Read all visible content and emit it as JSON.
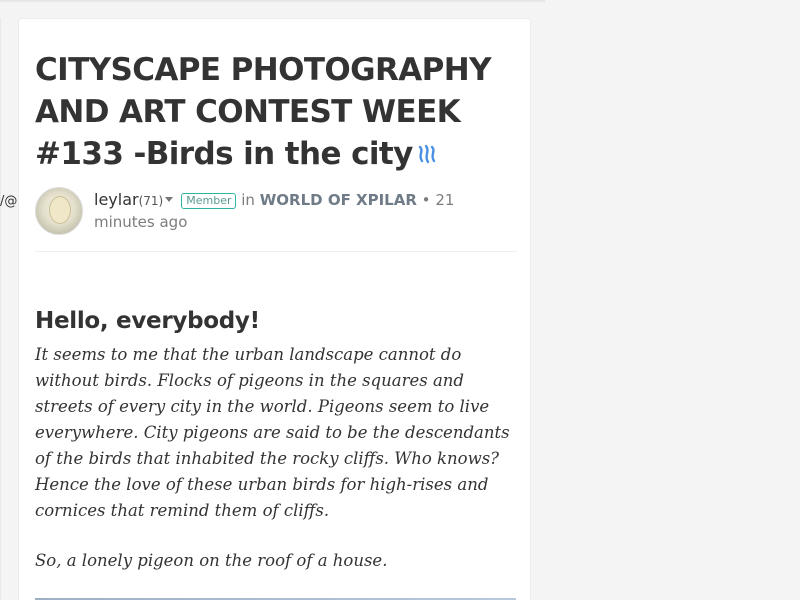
{
  "left_fragment": "/@",
  "post": {
    "title": "CITYSCAPE PHOTOGRAPHY AND ART CONTEST WEEK #133 -Birds in the city",
    "title_icon": "steem-icon",
    "author": {
      "name": "leylar",
      "reputation": "(71)",
      "badge": "Member"
    },
    "in_label": "in",
    "community": "WORLD OF XPILAR",
    "separator": "•",
    "time_ago": "21 minutes ago",
    "body": {
      "heading": "Hello, everybody!",
      "paragraph1": "It seems to me that the urban landscape cannot do without birds. Flocks of pigeons in the squares and streets of every city in the world. Pigeons seem to live everywhere. City pigeons are said to be the descendants of the birds that inhabited the rocky cliffs. Who knows? Hence the love of these urban birds for high-rises and cornices that remind them of cliffs.",
      "paragraph2": "So, a lonely pigeon on the roof of a house."
    }
  },
  "colors": {
    "badge_border": "#2bb5a3",
    "steem_icon": "#4a90e2",
    "text": "#333333",
    "muted": "#7d7d7d"
  }
}
